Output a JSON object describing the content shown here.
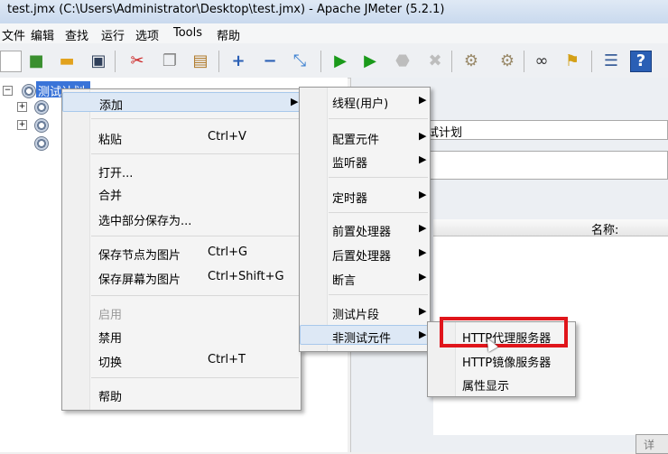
{
  "window": {
    "title": "test.jmx (C:\\Users\\Administrator\\Desktop\\test.jmx) - Apache JMeter (5.2.1)"
  },
  "menubar": [
    "文件",
    "编辑",
    "查找",
    "运行",
    "选项",
    "Tools",
    "帮助"
  ],
  "tree": {
    "selected_label": "测试计划"
  },
  "right": {
    "name_value": "试计划",
    "table_header_name": "名称:",
    "button_label": "详"
  },
  "context_menu": {
    "add": "添加",
    "paste": "粘贴",
    "paste_sc": "Ctrl+V",
    "open": "打开...",
    "merge": "合并",
    "save_selection": "选中部分保存为...",
    "save_node_image": "保存节点为图片",
    "save_node_image_sc": "Ctrl+G",
    "save_screen_image": "保存屏幕为图片",
    "save_screen_image_sc": "Ctrl+Shift+G",
    "enable": "启用",
    "disable": "禁用",
    "toggle": "切换",
    "toggle_sc": "Ctrl+T",
    "help": "帮助"
  },
  "add_submenu": {
    "threads": "线程(用户)",
    "config": "配置元件",
    "listener": "监听器",
    "timer": "定时器",
    "preprocessor": "前置处理器",
    "postprocessor": "后置处理器",
    "assertion": "断言",
    "test_fragment": "测试片段",
    "non_test": "非测试元件"
  },
  "non_test_submenu": {
    "http_proxy": "HTTP代理服务器",
    "http_mirror": "HTTP镜像服务器",
    "property_display": "属性显示"
  },
  "colors": {
    "selection": "#3a74d8",
    "highlight_box": "#e0151b"
  }
}
